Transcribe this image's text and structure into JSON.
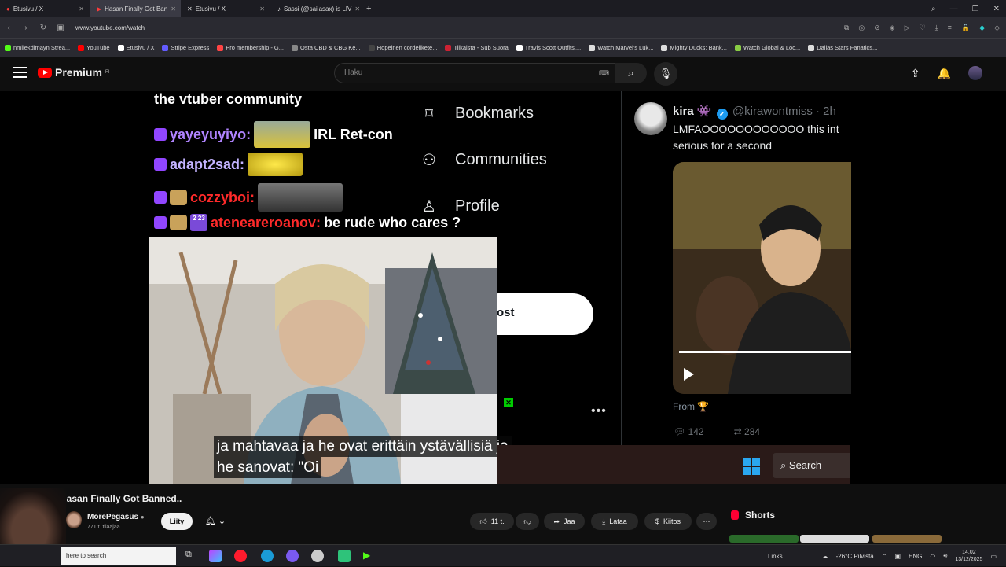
{
  "browser": {
    "tabs": [
      {
        "label": "Etusivu / X",
        "active": false
      },
      {
        "label": "Hasan Finally Got Ban",
        "active": true
      },
      {
        "label": "Etusivu / X",
        "active": false
      },
      {
        "label": "Sassi (@sailasax) is LIV",
        "active": false
      }
    ],
    "new_tab": "+",
    "url": "www.youtube.com/watch",
    "bookmarks": [
      {
        "label": "nmilekdimayn Strea...",
        "color": "#53fc18"
      },
      {
        "label": "YouTube",
        "color": "#ff0000"
      },
      {
        "label": "Etusivu / X",
        "color": "#ffffff"
      },
      {
        "label": "Stripe Express",
        "color": "#635bff"
      },
      {
        "label": "Pro membership - G...",
        "color": "#ff4444"
      },
      {
        "label": "Osta CBD & CBG Ke...",
        "color": "#888888"
      },
      {
        "label": "Hopeinen cordelikete...",
        "color": "#444444"
      },
      {
        "label": "Tilkaista - Sub Suora",
        "color": "#cc2233"
      },
      {
        "label": "Travis Scott Outfits,...",
        "color": "#ffffff"
      },
      {
        "label": "Watch Marvel's Luk...",
        "color": "#dddddd"
      },
      {
        "label": "Mighty Ducks: Bank...",
        "color": "#dddddd"
      },
      {
        "label": "Watch Global & Loc...",
        "color": "#88cc44"
      },
      {
        "label": "Dallas Stars Fanatics...",
        "color": "#dddddd"
      }
    ]
  },
  "youtube": {
    "logo_text": "Premium",
    "logo_sup": "FI",
    "search_placeholder": "Haku"
  },
  "stream": {
    "chat_title": "the vtuber community",
    "chat": [
      {
        "user": "yayeyuyiyo:",
        "user_color": "#b084ff",
        "message": "IRL Ret-con",
        "emote": "#d9c23a"
      },
      {
        "user": "adapt2sad:",
        "user_color": "#c3b3ff",
        "message": "",
        "emote": "#e0d030"
      },
      {
        "user": "cozzyboi:",
        "user_color": "#ff2a2a",
        "message": "",
        "emote": "#555555"
      },
      {
        "user": "ateneareroanov:",
        "user_color": "#ff2a2a",
        "message": "be rude who cares ?",
        "emote": ""
      }
    ],
    "badge_text": "2 23",
    "x_menu": [
      {
        "icon": "bookmark-icon",
        "glyph": "🔖",
        "label": "Bookmarks"
      },
      {
        "icon": "communities-icon",
        "glyph": "👥",
        "label": "Communities"
      },
      {
        "icon": "profile-icon",
        "glyph": "👤",
        "label": "Profile"
      }
    ],
    "post_button": "ost",
    "subtitle_lines": [
      "ja mahtavaa ja he ovat erittäin ystävällisiä ja",
      "he sanovat: \"Oi"
    ],
    "tweet": {
      "name": "kira",
      "handle": "@kirawontmiss · 2h",
      "text_line1": "LMFAOOOOOOOOOOOO this int",
      "text_line2": "serious for a second",
      "from": "From 🏆",
      "replies": "142",
      "retweets": "284"
    },
    "overlay_search": "Search"
  },
  "video": {
    "title": "Hasan Finally Got Banned..",
    "channel": "MorePegasus",
    "subscribers": "771 t. tilaajaa",
    "join_label": "Liity",
    "like_count": "11 t.",
    "share_label": "Jaa",
    "download_label": "Lataa",
    "thanks_label": "Kiitos",
    "shorts_label": "Shorts"
  },
  "taskbar": {
    "search_placeholder": "here to search",
    "links_label": "Links",
    "weather": "-26°C Pilvistä",
    "lang": "ENG",
    "time": "14.02",
    "date": "13/12/2025"
  }
}
